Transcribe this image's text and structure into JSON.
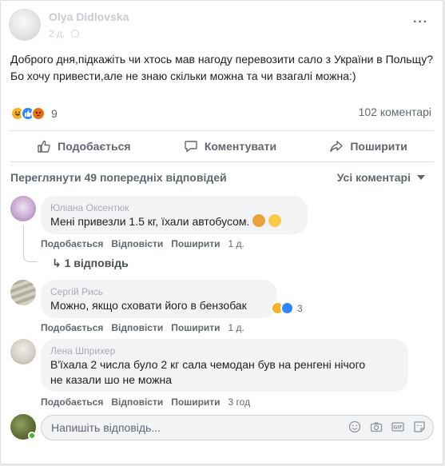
{
  "post": {
    "author": "Olya Didlovska",
    "time": "2 д.",
    "more": "···",
    "text": "Доброго дня,підкажіть чи хтось мав нагоду перевозити сало з України в Польщу? Бо хочу привести,але не знаю скільки можна та чи взагалі можна:)",
    "reaction_icons": [
      "haha",
      "like",
      "angry"
    ],
    "reaction_count": "9",
    "comments_count": "102 коментарі"
  },
  "actions": {
    "like": "Подобається",
    "comment": "Коментувати",
    "share": "Поширити"
  },
  "comments_bar": {
    "view_previous": "Переглянути 49 попередніх відповідей",
    "filter": "Усі коментарі"
  },
  "comments": [
    {
      "name": "Юліана Оксентюк",
      "text": "Мені привезли 1.5 кг, їхали автобусом.",
      "like": "Подобається",
      "reply": "Відповісти",
      "share": "Поширити",
      "time": "1 д.",
      "replies": "1 відповідь"
    },
    {
      "name": "Сергій Рись",
      "text": "Можно, якщо сховати його в бензобак",
      "like": "Подобається",
      "reply": "Відповісти",
      "share": "Поширити",
      "time": "1 д.",
      "reaction_count": "3"
    },
    {
      "name": "Лена Шприхер",
      "text_line1": "В'їхала 2 числа було 2 кг сала чемодан був на ренгені нічого",
      "text_line2": "не казали шо не можна",
      "like": "Подобається",
      "reply": "Відповісти",
      "share": "Поширити",
      "time": "3 год"
    }
  ],
  "reply": {
    "placeholder": "Напишіть відповідь..."
  },
  "colors": {
    "like_blue": "#2d88ff",
    "haha_yellow": "#f7b125",
    "angry_orange": "#e9710f",
    "online_green": "#42b72a"
  }
}
